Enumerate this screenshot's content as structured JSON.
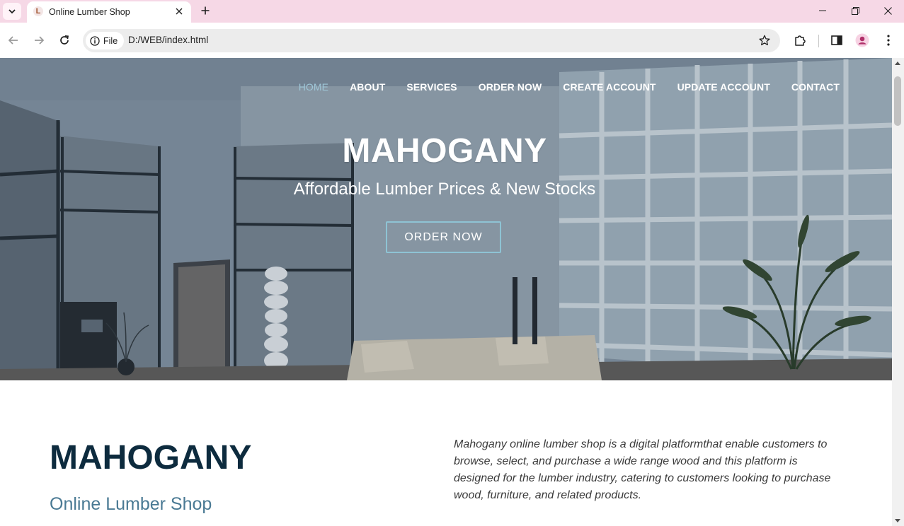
{
  "browser": {
    "tab_title": "Online Lumber Shop",
    "favicon_letter": "L",
    "scheme_chip": "File",
    "url": "D:/WEB/index.html"
  },
  "nav": {
    "items": [
      {
        "label": "HOME",
        "active": true
      },
      {
        "label": "ABOUT"
      },
      {
        "label": "SERVICES"
      },
      {
        "label": "ORDER NOW"
      },
      {
        "label": "CREATE ACCOUNT"
      },
      {
        "label": "UPDATE ACCOUNT"
      },
      {
        "label": "CONTACT"
      }
    ]
  },
  "hero": {
    "title": "MAHOGANY",
    "subtitle": "Affordable Lumber Prices & New Stocks",
    "cta": "ORDER NOW"
  },
  "about": {
    "title": "MAHOGANY",
    "subtitle": "Online Lumber Shop",
    "description": "Mahogany online lumber shop is a digital platformthat enable customers to browse, select, and purchase a wide range wood and this platform is designed for the lumber industry, catering to customers looking to purchase wood, furniture, and related products."
  },
  "colors": {
    "tabbar_bg": "#f6d8e6",
    "nav_active": "#9fc7d8",
    "heading_dark": "#0d2b3e",
    "subheading": "#4a7a94",
    "cta_border": "#8ec3d4"
  }
}
